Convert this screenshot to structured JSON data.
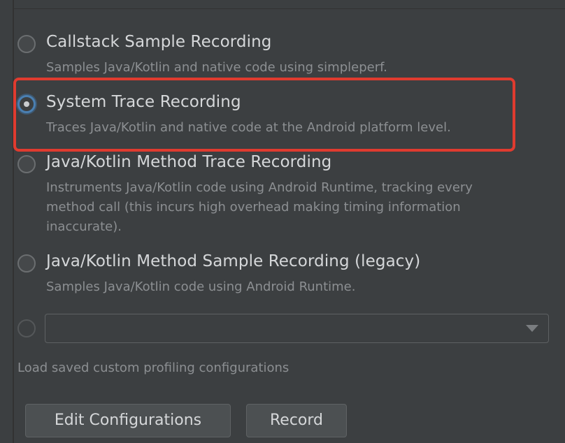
{
  "profiling_options": [
    {
      "title": "Callstack Sample Recording",
      "description": [
        "Samples Java/Kotlin and native code using simpleperf."
      ],
      "selected": false
    },
    {
      "title": "System Trace Recording",
      "description": [
        "Traces Java/Kotlin and native code at the Android platform level."
      ],
      "selected": true
    },
    {
      "title": "Java/Kotlin Method Trace Recording",
      "description": [
        "Instruments Java/Kotlin code using Android Runtime, tracking every",
        "method call (this incurs high overhead making timing information",
        "inaccurate)."
      ],
      "selected": false
    },
    {
      "title": "Java/Kotlin Method Sample Recording (legacy)",
      "description": [
        "Samples Java/Kotlin code using Android Runtime."
      ],
      "selected": false
    }
  ],
  "custom_config": {
    "selected_value": "",
    "enabled": false
  },
  "load_saved_label": "Load saved custom profiling configurations",
  "buttons": {
    "edit_configurations": "Edit Configurations",
    "record": "Record"
  },
  "colors": {
    "background": "#3c3f41",
    "highlight_box": "#e03b2f",
    "radio_focus": "#4a7fb1"
  },
  "icons": {
    "combo_arrow": "chevron-down-icon"
  }
}
